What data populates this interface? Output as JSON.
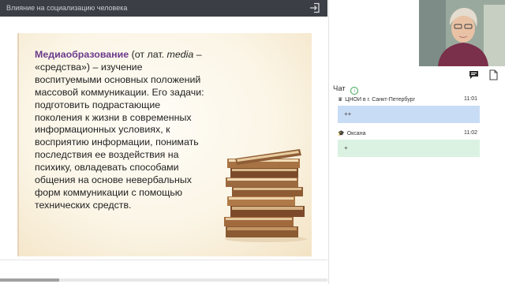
{
  "window": {
    "title": "Влияние на социализацию человека"
  },
  "slide": {
    "term": "Медиаобразование",
    "text_1": " (от лат. ",
    "latin": "media",
    "text_2": " – «средства») – изучение воспитуемыми основных положений массовой коммуникации. Его задачи: подготовить подрастающие поколения к жизни в современных информационных условиях, к восприятию информации, понимать последствия ее воздействия на психику, овладевать способами общения на основе невербальных форм коммуникации с помощью технических средств."
  },
  "progress": {
    "value": 0.18
  },
  "chat": {
    "title": "Чат",
    "messages": [
      {
        "author": "ЦНОИ в г. Санкт-Петербург",
        "time": "11:01",
        "text": "++",
        "author_icon": "crown-icon",
        "bubble_color": "#c9dcf5"
      },
      {
        "author": "Оксана",
        "time": "11:02",
        "text": "+",
        "author_icon": "graduation-cap-icon",
        "bubble_color": "#dbf2e2"
      }
    ]
  },
  "icons": [
    "exit-icon",
    "chat-icon",
    "document-icon",
    "download-icon",
    "books-image"
  ]
}
